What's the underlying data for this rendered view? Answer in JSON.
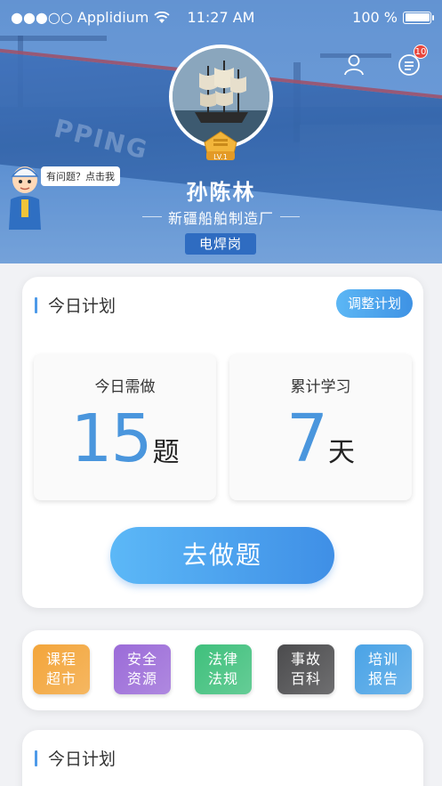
{
  "status_bar": {
    "carrier": "●●●○○ Applidium",
    "time": "11:27 AM",
    "battery": "100 %",
    "battery_level": 1.0
  },
  "header": {
    "notification_count": "10",
    "level": "LV.1",
    "name": "孙陈林",
    "company": "新疆船舶制造厂",
    "post": "电焊岗",
    "help_bubble": "有问题？点击我",
    "banner_text": "PPING"
  },
  "plan": {
    "title": "今日计划",
    "adjust_label": "调整计划",
    "today": {
      "label": "今日需做",
      "value": "15",
      "unit": "题"
    },
    "total": {
      "label": "累计学习",
      "value": "7",
      "unit": "天"
    },
    "go_label": "去做题"
  },
  "modules": [
    {
      "line1": "课程",
      "line2": "超市",
      "color": "#f3a53a"
    },
    {
      "line1": "安全",
      "line2": "资源",
      "color": "#9b6bd8"
    },
    {
      "line1": "法律",
      "line2": "法规",
      "color": "#3fc07c"
    },
    {
      "line1": "事故",
      "line2": "百科",
      "color": "#4b4b4d"
    },
    {
      "line1": "培训",
      "line2": "报告",
      "color": "#4aa3e6"
    }
  ],
  "plan2": {
    "title": "今日计划"
  }
}
